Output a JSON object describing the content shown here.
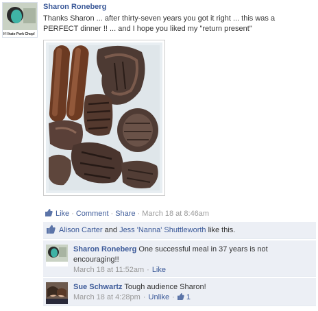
{
  "post": {
    "author": "Sharon Roneberg",
    "avatar_caption": "If I hate Pork Chop!",
    "message": "Thanks Sharon ... after thirty-seven years you got it right ... this was a PERFECT dinner !! ... and I hope you liked my \"return present\"",
    "photo_alt": "grilled meat on a plate"
  },
  "actions": {
    "like": "Like",
    "comment": "Comment",
    "share": "Share",
    "timestamp": "March 18 at 8:46am",
    "separator": "·"
  },
  "likes": {
    "person1": "Alison Carter",
    "and": "and",
    "person2": "Jess 'Nanna' Shuttleworth",
    "suffix": "like this."
  },
  "comments": [
    {
      "author": "Sharon Roneberg",
      "text": "One successful meal in 37 years is not encouraging!!",
      "timestamp": "March 18 at 11:52am",
      "like": "Like"
    },
    {
      "author": "Sue Schwartz",
      "text": "Tough audience Sharon!",
      "timestamp": "March 18 at 4:28pm",
      "unlike": "Unlike",
      "like_count": "1"
    }
  ],
  "colors": {
    "link": "#3b5998",
    "meta": "#999999",
    "feedback_bg": "#eceff5",
    "text": "#333333"
  },
  "icons": [
    "like-thumb-icon",
    "comment-like-thumb-icon"
  ]
}
